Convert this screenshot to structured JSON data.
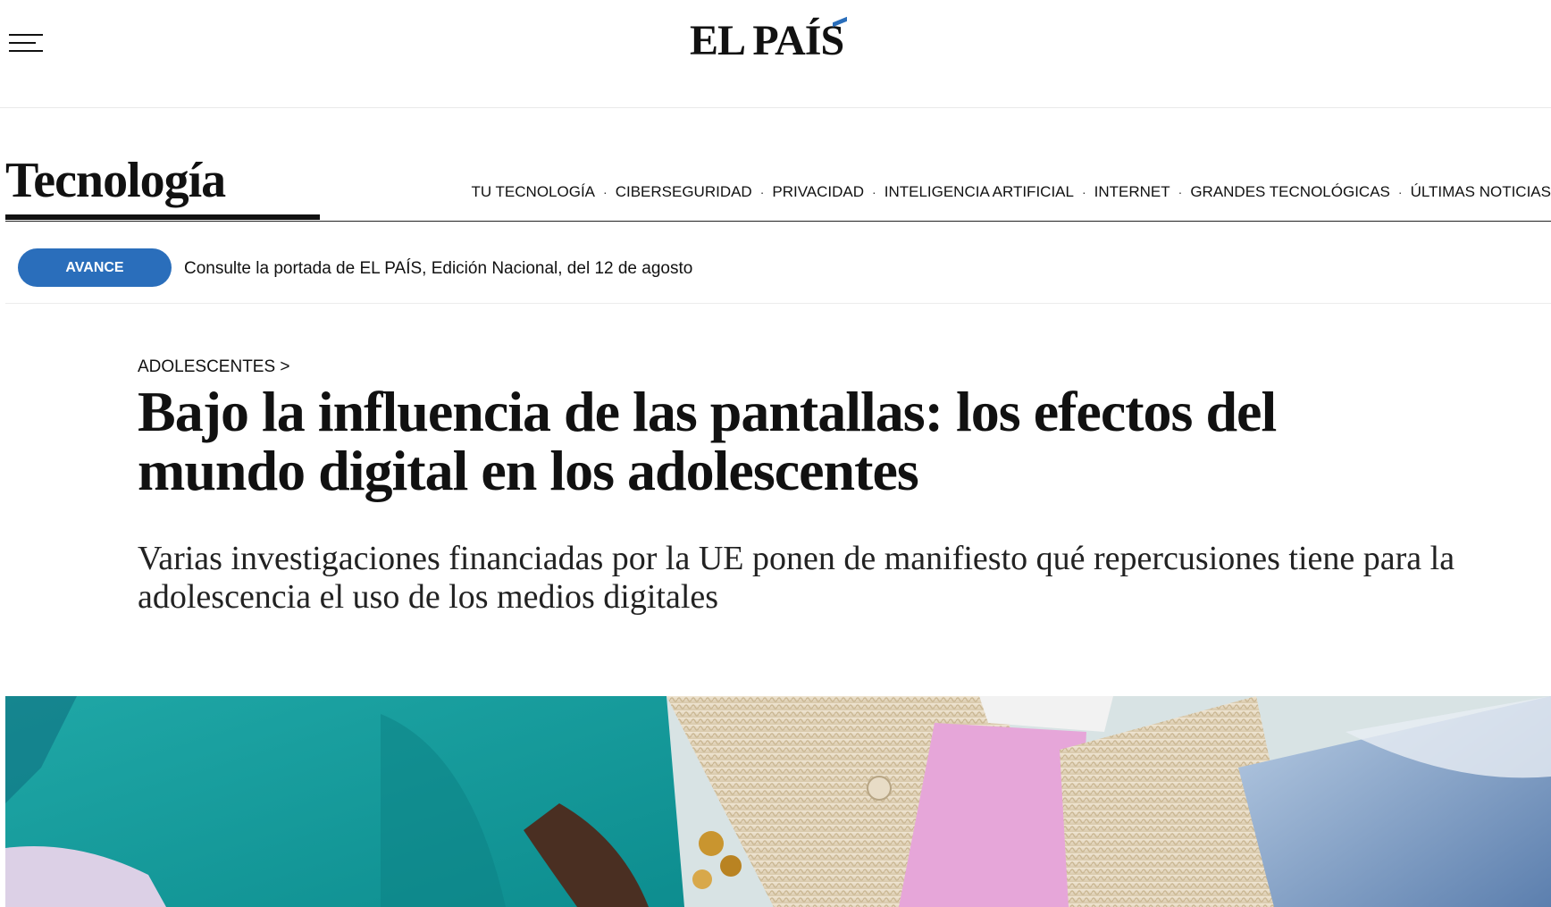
{
  "header": {
    "menu_icon": "hamburger-menu-icon",
    "logo_text": "EL PAÍS",
    "colors": {
      "accent": "#2a6ebb"
    }
  },
  "section": {
    "title": "Tecnología",
    "nav": [
      "TU TECNOLOGÍA",
      "CIBERSEGURIDAD",
      "PRIVACIDAD",
      "INTELIGENCIA ARTIFICIAL",
      "INTERNET",
      "GRANDES TECNOLÓGICAS",
      "ÚLTIMAS NOTICIAS"
    ],
    "separator": "·"
  },
  "avance": {
    "badge": "AVANCE",
    "text": "Consulte la portada de EL PAÍS, Edición Nacional, del 12 de agosto"
  },
  "article": {
    "kicker": "ADOLESCENTES >",
    "headline": "Bajo la influencia de las pantallas: los efectos del mundo digital en los adolescentes",
    "subtitle": "Varias investigaciones financiadas por la UE ponen de manifiesto qué repercusiones tiene para la adolescencia el uso de los medios digitales"
  }
}
